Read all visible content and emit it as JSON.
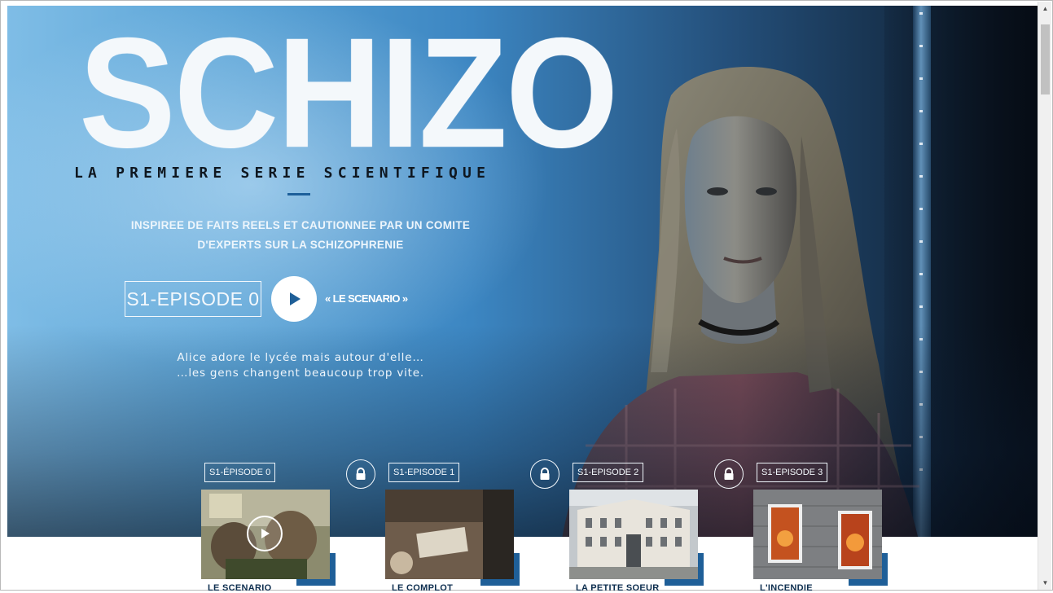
{
  "hero": {
    "title": "SCHIZO",
    "subtitle": "LA PREMIERE SERIE SCIENTIFIQUE",
    "tagline_line1": "INSPIREE DE FAITS REELS ET CAUTIONNEE PAR UN COMITE",
    "tagline_line2": "D'EXPERTS SUR LA SCHIZOPHRENIE",
    "episode_label": "S1-EPISODE 0",
    "scenario_link": "« LE SCENARIO »",
    "description_line1": "Alice adore le lycée mais autour d'elle…",
    "description_line2": "…les gens changent beaucoup trop vite."
  },
  "episodes": [
    {
      "label": "S1-ÉPISODE 0",
      "name": "LE SCENARIO",
      "locked": false,
      "icon": "play-icon"
    },
    {
      "label": "S1-EPISODE 1",
      "name": "LE COMPLOT",
      "locked": true,
      "icon": "lock-icon"
    },
    {
      "label": "S1-EPISODE 2",
      "name": "LA PETITE SOEUR",
      "locked": true,
      "icon": "lock-icon"
    },
    {
      "label": "S1-EPISODE 3",
      "name": "L'INCENDIE",
      "locked": true,
      "icon": "lock-icon"
    }
  ],
  "colors": {
    "accent": "#1f5f98",
    "hero_blue": "#3c86c2",
    "text_light": "#f3f8fc"
  }
}
